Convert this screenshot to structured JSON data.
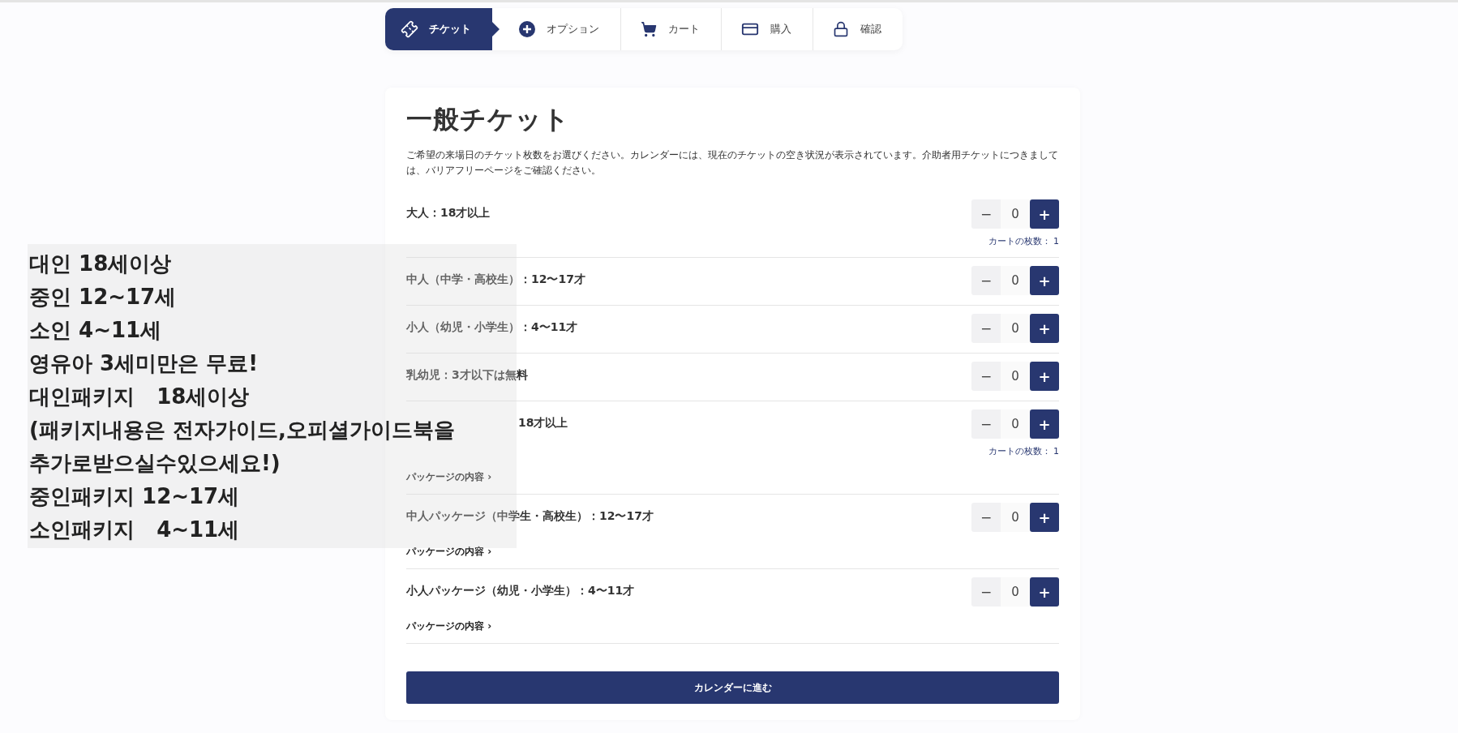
{
  "steps": [
    {
      "label": "チケット",
      "kind": "ticket",
      "selected": true
    },
    {
      "label": "オプション",
      "kind": "plus",
      "selected": false
    },
    {
      "label": "カート",
      "kind": "cart",
      "selected": false
    },
    {
      "label": "購入",
      "kind": "card",
      "selected": false
    },
    {
      "label": "確認",
      "kind": "lock",
      "selected": false
    }
  ],
  "card": {
    "title": "一般チケット",
    "description": "ご希望の来場日のチケット枚数をお選びください。カレンダーには、現在のチケットの空き状況が表示されています。介助者用チケットにつきましては、バリアフリーページをご確認ください。",
    "tickets": [
      {
        "label": "大人：18才以上",
        "minus": "−",
        "count": "0",
        "plus": "+",
        "cart_count": "カートの枚数： 1"
      },
      {
        "label": "中人（中学・高校生）：12〜17才",
        "minus": "−",
        "count": "0",
        "plus": "+"
      },
      {
        "label": "小人（幼児・小学生）：4〜11才",
        "minus": "−",
        "count": "0",
        "plus": "+"
      },
      {
        "label": "乳幼児：3才以下は無料",
        "minus": "−",
        "count": "0",
        "plus": "+"
      },
      {
        "label": "18才以上",
        "covered": true,
        "minus": "−",
        "count": "0",
        "plus": "+",
        "cart_count": "カートの枚数： 1",
        "link": "パッケージの内容 ›"
      },
      {
        "label": "中人パッケージ（中学生・高校生）：12〜17才",
        "minus": "−",
        "count": "0",
        "plus": "+",
        "link": "パッケージの内容 ›"
      },
      {
        "label": "小人パッケージ（幼児・小学生）：4〜11才",
        "minus": "−",
        "count": "0",
        "plus": "+",
        "link": "パッケージの内容 ›"
      }
    ],
    "submit": "カレンダーに進む"
  },
  "overlay_note": {
    "lines": [
      "대인 18세이상",
      "중인 12~17세",
      "소인 4~11세",
      "영유아 3세미만은 무료!",
      "대인패키지   18세이상",
      "(패키지내용은 전자가이드,오피셜가이드북을",
      "추가로받으실수있으세요!)",
      "중인패키지 12~17세",
      "소인패키지   4~11세"
    ]
  }
}
